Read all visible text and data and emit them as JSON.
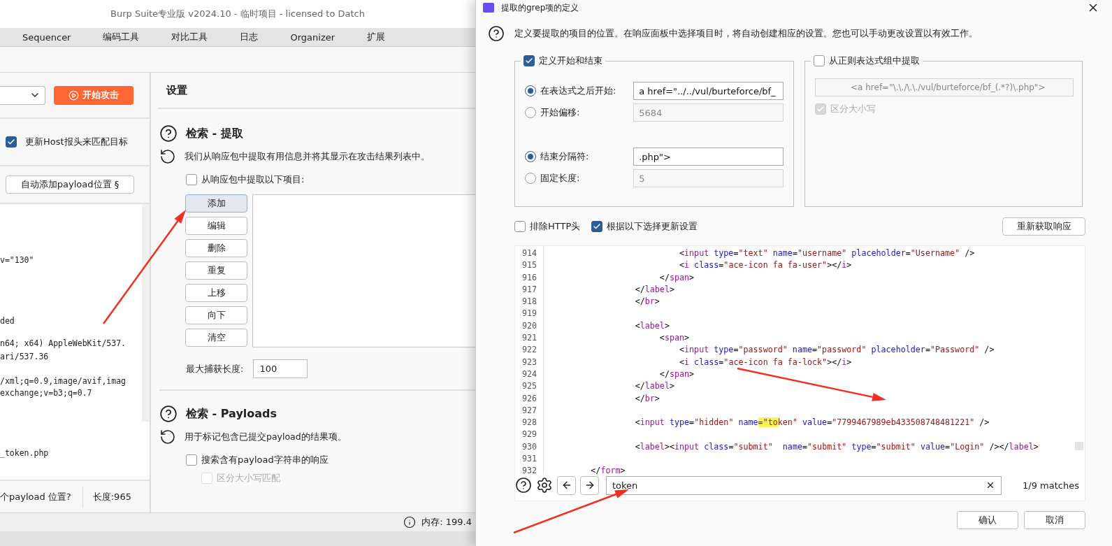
{
  "main_window": {
    "title": "Burp Suite专业版  v2024.10 - 临时项目 - licensed to Datch",
    "menu": [
      "Sequencer",
      "编码工具",
      "对比工具",
      "日志",
      "Organizer",
      "扩展"
    ],
    "attack_panel": {
      "start_button": "开始攻击",
      "update_host": {
        "label": "更新Host报头来匹配目标",
        "checked": true
      },
      "auto_add_button": "自动添加payload位置 §",
      "request_lines": [
        "v=\"130\"",
        "ded",
        "n64; x64) AppleWebKit/537.",
        "ari/537.36",
        "/xml;q=0.9,image/avif,imag",
        "exchange;v=b3;q=0.7",
        "_token.php"
      ],
      "footer": {
        "positions": "个payload 位置?",
        "length": "长度:965"
      }
    },
    "settings": {
      "title": "设置",
      "extract": {
        "title": "检索 - 提取",
        "description": "我们从响应包中提取有用信息并将其显示在攻击结果列表中。",
        "checkbox": {
          "label": "从响应包中提取以下项目:",
          "checked": false
        },
        "buttons": [
          {
            "label": "添加",
            "selected": true
          },
          {
            "label": "编辑",
            "selected": false
          },
          {
            "label": "删除",
            "selected": false
          },
          {
            "label": "重复",
            "selected": false
          },
          {
            "label": "上移",
            "selected": false
          },
          {
            "label": "向下",
            "selected": false
          },
          {
            "label": "清空",
            "selected": false
          }
        ],
        "max_length": {
          "label": "最大捕获长度:",
          "value": "100"
        }
      },
      "payloads": {
        "title": "检索 - Payloads",
        "description": "用于标记包含已提交payload的结果项。",
        "checkboxes": [
          {
            "label": "搜索含有payload字符串的响应",
            "checked": false,
            "disabled": false
          },
          {
            "label": "区分大小写匹配",
            "checked": false,
            "disabled": true
          }
        ]
      }
    },
    "status_bar": {
      "memory": "内存: 199.4"
    }
  },
  "dialog": {
    "title": "提取的grep项的定义",
    "intro": "定义要提取的项目的位置。在响应面板中选择项目时，将自动创建相应的设置。您也可以手动更改设置以有效工作。",
    "start_end": {
      "label": "定义开始和结束",
      "checked": true,
      "options": [
        {
          "label": "在表达式之后开始:",
          "selected": true,
          "value": "a href=\"../../vul/burteforce/bf_"
        },
        {
          "label": "开始偏移:",
          "selected": false,
          "value": "5684"
        },
        {
          "label": "结束分隔符:",
          "selected": true,
          "value": ".php\">"
        },
        {
          "label": "固定长度:",
          "selected": false,
          "value": "5"
        }
      ]
    },
    "regex": {
      "label": "从正则表达式组中提取",
      "checked": false,
      "value": "<a href=\"\\.\\./\\.\\./vul/burteforce/bf_(.*?)\\.php\">",
      "case": {
        "label": "区分大小写",
        "checked": true,
        "disabled": true
      }
    },
    "exclude_http": {
      "label": "排除HTTP头",
      "checked": false
    },
    "update_settings": {
      "label": "根据以下选择更新设置",
      "checked": true
    },
    "refetch_button": "重新获取响应",
    "code_lines": [
      {
        "number": "914",
        "tokens": [
          {
            "kind": "punct",
            "text": "                           <"
          },
          {
            "kind": "tag",
            "text": "input"
          },
          {
            "kind": "attr",
            "text": " type"
          },
          {
            "kind": "punct",
            "text": "="
          },
          {
            "kind": "value",
            "text": "\"text\""
          },
          {
            "kind": "attr",
            "text": " name"
          },
          {
            "kind": "punct",
            "text": "="
          },
          {
            "kind": "value",
            "text": "\"username\""
          },
          {
            "kind": "attr",
            "text": " placeholder"
          },
          {
            "kind": "punct",
            "text": "="
          },
          {
            "kind": "value",
            "text": "\"Username\""
          },
          {
            "kind": "punct",
            "text": " />"
          }
        ]
      },
      {
        "number": "915",
        "tokens": [
          {
            "kind": "punct",
            "text": "                           <"
          },
          {
            "kind": "tag",
            "text": "i"
          },
          {
            "kind": "attr",
            "text": " class"
          },
          {
            "kind": "punct",
            "text": "="
          },
          {
            "kind": "value",
            "text": "\"ace-icon fa fa-user\""
          },
          {
            "kind": "punct",
            "text": "></"
          },
          {
            "kind": "tag",
            "text": "i"
          },
          {
            "kind": "punct",
            "text": ">"
          }
        ]
      },
      {
        "number": "916",
        "tokens": [
          {
            "kind": "punct",
            "text": "                       </"
          },
          {
            "kind": "tag",
            "text": "span"
          },
          {
            "kind": "punct",
            "text": ">"
          }
        ]
      },
      {
        "number": "917",
        "tokens": [
          {
            "kind": "punct",
            "text": "                  </"
          },
          {
            "kind": "tag",
            "text": "label"
          },
          {
            "kind": "punct",
            "text": ">"
          }
        ]
      },
      {
        "number": "918",
        "tokens": [
          {
            "kind": "punct",
            "text": "                  </"
          },
          {
            "kind": "tag",
            "text": "br"
          },
          {
            "kind": "punct",
            "text": ">"
          }
        ]
      },
      {
        "number": "919"
      },
      {
        "number": "920",
        "tokens": [
          {
            "kind": "punct",
            "text": "                  <"
          },
          {
            "kind": "tag",
            "text": "label"
          },
          {
            "kind": "punct",
            "text": ">"
          }
        ]
      },
      {
        "number": "921",
        "tokens": [
          {
            "kind": "punct",
            "text": "                       <"
          },
          {
            "kind": "tag",
            "text": "span"
          },
          {
            "kind": "punct",
            "text": ">"
          }
        ]
      },
      {
        "number": "922",
        "tokens": [
          {
            "kind": "punct",
            "text": "                           <"
          },
          {
            "kind": "tag",
            "text": "input"
          },
          {
            "kind": "attr",
            "text": " type"
          },
          {
            "kind": "punct",
            "text": "="
          },
          {
            "kind": "value",
            "text": "\"password\""
          },
          {
            "kind": "attr",
            "text": " name"
          },
          {
            "kind": "punct",
            "text": "="
          },
          {
            "kind": "value",
            "text": "\"password\""
          },
          {
            "kind": "attr",
            "text": " placeholder"
          },
          {
            "kind": "punct",
            "text": "="
          },
          {
            "kind": "value",
            "text": "\"Password\""
          },
          {
            "kind": "punct",
            "text": " />"
          }
        ]
      },
      {
        "number": "923",
        "tokens": [
          {
            "kind": "punct",
            "text": "                           <"
          },
          {
            "kind": "tag",
            "text": "i"
          },
          {
            "kind": "attr",
            "text": " class"
          },
          {
            "kind": "punct",
            "text": "="
          },
          {
            "kind": "value",
            "text": "\"ace-icon fa fa-lock\""
          },
          {
            "kind": "punct",
            "text": "></"
          },
          {
            "kind": "tag",
            "text": "i"
          },
          {
            "kind": "punct",
            "text": ">"
          }
        ]
      },
      {
        "number": "924",
        "tokens": [
          {
            "kind": "punct",
            "text": "                       </"
          },
          {
            "kind": "tag",
            "text": "span"
          },
          {
            "kind": "punct",
            "text": ">"
          }
        ]
      },
      {
        "number": "925",
        "tokens": [
          {
            "kind": "punct",
            "text": "                  </"
          },
          {
            "kind": "tag",
            "text": "label"
          },
          {
            "kind": "punct",
            "text": ">"
          }
        ]
      },
      {
        "number": "926",
        "tokens": [
          {
            "kind": "punct",
            "text": "                  </"
          },
          {
            "kind": "tag",
            "text": "br"
          },
          {
            "kind": "punct",
            "text": ">"
          }
        ]
      },
      {
        "number": "927"
      },
      {
        "number": "928",
        "tokens": [
          {
            "kind": "punct",
            "text": "                  <"
          },
          {
            "kind": "tag",
            "text": "input"
          },
          {
            "kind": "attr",
            "text": " type"
          },
          {
            "kind": "punct",
            "text": "="
          },
          {
            "kind": "value",
            "text": "\"hidden\""
          },
          {
            "kind": "attr",
            "text": " name"
          },
          {
            "kind": "mark",
            "text": "=\"to"
          },
          {
            "kind": "value",
            "text": "ken\""
          },
          {
            "kind": "attr",
            "text": " value"
          },
          {
            "kind": "punct",
            "text": "="
          },
          {
            "kind": "value",
            "text": "\"7799467989eb433508748481221\""
          },
          {
            "kind": "punct",
            "text": " />"
          }
        ]
      },
      {
        "number": "929"
      },
      {
        "number": "930",
        "tokens": [
          {
            "kind": "punct",
            "text": "                  <"
          },
          {
            "kind": "tag",
            "text": "label"
          },
          {
            "kind": "punct",
            "text": "><"
          },
          {
            "kind": "tag",
            "text": "input"
          },
          {
            "kind": "attr",
            "text": " class"
          },
          {
            "kind": "punct",
            "text": "="
          },
          {
            "kind": "value",
            "text": "\"submit\""
          },
          {
            "kind": "attr",
            "text": "  name"
          },
          {
            "kind": "punct",
            "text": "="
          },
          {
            "kind": "value",
            "text": "\"submit\""
          },
          {
            "kind": "attr",
            "text": " type"
          },
          {
            "kind": "punct",
            "text": "="
          },
          {
            "kind": "value",
            "text": "\"submit\""
          },
          {
            "kind": "attr",
            "text": " value"
          },
          {
            "kind": "punct",
            "text": "="
          },
          {
            "kind": "value",
            "text": "\"Login\""
          },
          {
            "kind": "punct",
            "text": " /></"
          },
          {
            "kind": "tag",
            "text": "label"
          },
          {
            "kind": "punct",
            "text": ">"
          }
        ]
      },
      {
        "number": "931"
      },
      {
        "number": "932",
        "tokens": [
          {
            "kind": "punct",
            "text": "         </"
          },
          {
            "kind": "tag",
            "text": "form"
          },
          {
            "kind": "punct",
            "text": ">"
          }
        ]
      }
    ],
    "search": {
      "value": "token",
      "matches": "1/9 matches"
    },
    "buttons": [
      "确认",
      "取消"
    ]
  }
}
